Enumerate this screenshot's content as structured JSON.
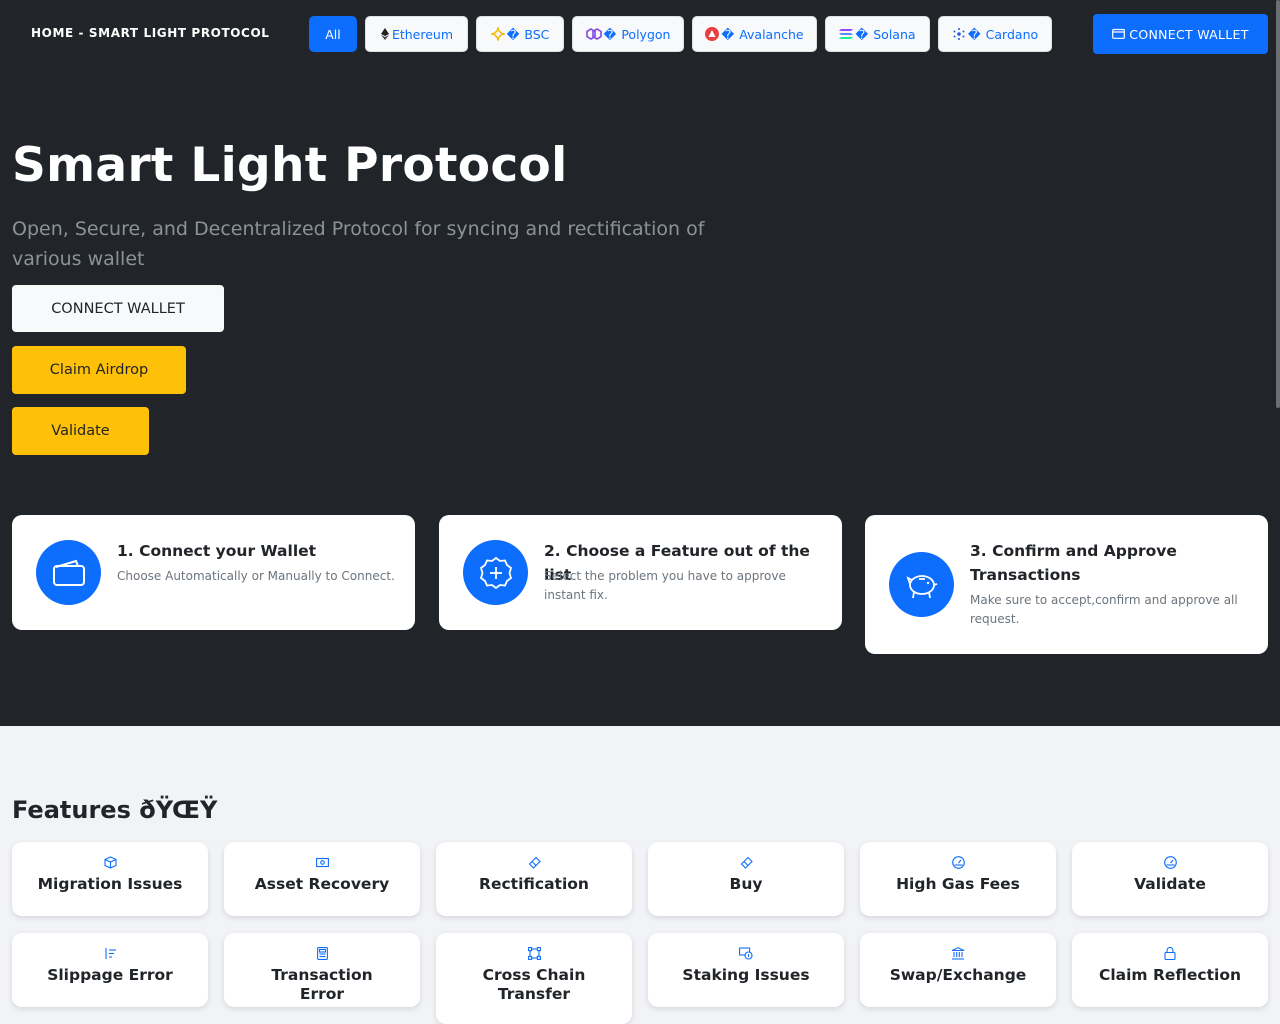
{
  "nav": {
    "brand": "HOME - SMART LIGHT PROTOCOL",
    "chains": [
      {
        "label": "All",
        "icon": ""
      },
      {
        "label": "Ethereum",
        "icon": "ethereum-icon"
      },
      {
        "label": "BSC",
        "icon": "bsc-icon"
      },
      {
        "label": "Polygon",
        "icon": "polygon-icon"
      },
      {
        "label": "Avalanche",
        "icon": "avalanche-icon"
      },
      {
        "label": "Solana",
        "icon": "solana-icon"
      },
      {
        "label": "Cardano",
        "icon": "cardano-icon"
      }
    ],
    "chain_glyph": "�",
    "connect_label": "CONNECT WALLET"
  },
  "hero": {
    "title": "Smart Light Protocol",
    "subtitle": "Open, Secure, and Decentralized Protocol for syncing and rectification of various wallet",
    "connect_label": "CONNECT WALLET",
    "airdrop_label": "Claim Airdrop",
    "validate_label": "Validate"
  },
  "steps": [
    {
      "title": "1. Connect your Wallet",
      "desc": "Choose Automatically or Manually to Connect.",
      "icon": "wallet-icon"
    },
    {
      "title": "2. Choose a Feature out of the list",
      "desc": "Select the problem you have to approve instant fix.",
      "icon": "plus-circle-icon"
    },
    {
      "title": "3. Confirm and Approve Transactions",
      "desc": "Make sure to accept,confirm and approve all request.",
      "icon": "piggy-bank-icon"
    }
  ],
  "features": {
    "title": "Features ðŸŒŸ",
    "items": [
      {
        "label": "Migration Issues",
        "icon": "box-icon"
      },
      {
        "label": "Asset Recovery",
        "icon": "cash-icon"
      },
      {
        "label": "Rectification",
        "icon": "eraser-icon"
      },
      {
        "label": "Buy",
        "icon": "eraser-icon"
      },
      {
        "label": "High Gas Fees",
        "icon": "speedometer-icon"
      },
      {
        "label": "Validate",
        "icon": "speedometer-icon"
      },
      {
        "label": "Slippage Error",
        "icon": "sort-icon"
      },
      {
        "label": "Transaction Error",
        "icon": "calculator-icon"
      },
      {
        "label": "Cross Chain Transfer",
        "icon": "bounding-box-icon"
      },
      {
        "label": "Staking Issues",
        "icon": "coin-icon"
      },
      {
        "label": "Swap/Exchange",
        "icon": "bank-icon"
      },
      {
        "label": "Claim Reflection",
        "icon": "lock-icon"
      }
    ]
  },
  "colors": {
    "primary": "#0d6efd",
    "warning": "#ffc107",
    "dark": "#212529",
    "light": "#f8f9fa"
  }
}
